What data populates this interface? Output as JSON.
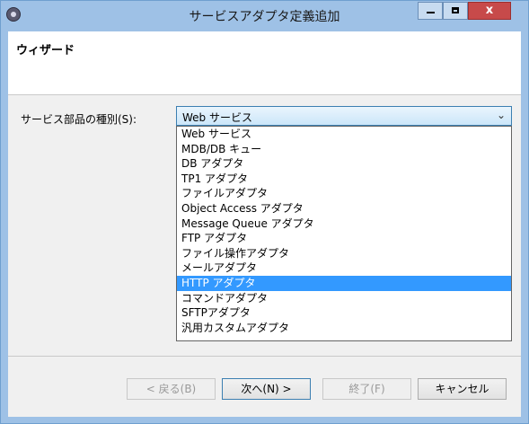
{
  "window": {
    "title": "サービスアダプタ定義追加",
    "close_label": "x"
  },
  "wizard": {
    "title": "ウィザード"
  },
  "form": {
    "service_kind_label": "サービス部品の種別(S):",
    "selected_value": "Web サービス",
    "options": [
      "Web サービス",
      "MDB/DB キュー",
      "DB アダプタ",
      "TP1 アダプタ",
      "ファイルアダプタ",
      "Object Access アダプタ",
      "Message Queue アダプタ",
      "FTP アダプタ",
      "ファイル操作アダプタ",
      "メールアダプタ",
      "HTTP アダプタ",
      "コマンドアダプタ",
      "SFTPアダプタ",
      "汎用カスタムアダプタ"
    ],
    "highlighted_option": "HTTP アダプタ"
  },
  "buttons": {
    "back": "< 戻る(B)",
    "next": "次へ(N) >",
    "finish": "終了(F)",
    "cancel": "キャンセル"
  },
  "colors": {
    "titlebar": "#9ec1e6",
    "selection": "#3399ff",
    "close": "#c74a4a"
  },
  "icons": {
    "app": "app-gear-icon",
    "dropdown": "chevron-down-icon"
  }
}
